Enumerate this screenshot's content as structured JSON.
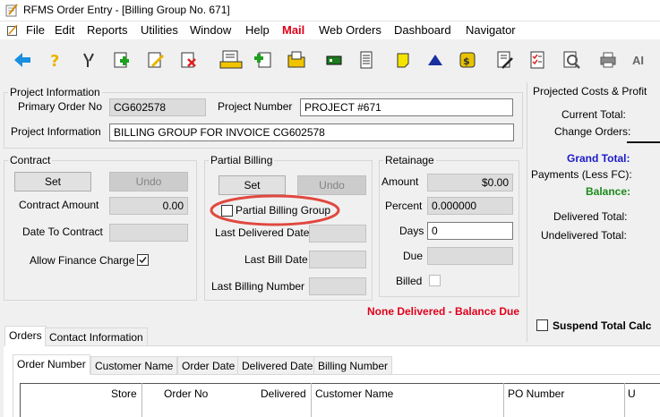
{
  "window": {
    "title": "RFMS Order Entry - [Billing Group No. 671]"
  },
  "menu": [
    "File",
    "Edit",
    "Reports",
    "Utilities",
    "Window",
    "Help",
    "Mail",
    "Web Orders",
    "Dashboard",
    "Navigator"
  ],
  "toolbar": {
    "icons": [
      "back-arrow-icon",
      "help-question-icon",
      "tools-icon",
      "add-order-icon",
      "edit-order-icon",
      "delete-order-icon",
      "printed-report-icon",
      "add-document-icon",
      "folder-icon",
      "green-card-icon",
      "document-icon",
      "sticky-note-icon",
      "triangle-icon",
      "calculator-icon",
      "signing-icon",
      "checklist-icon",
      "magnify-document-icon",
      "printer-icon",
      "ai-icon"
    ],
    "ai_label": "AI"
  },
  "project_info": {
    "legend": "Project Information",
    "primary_order_label": "Primary Order No",
    "primary_order_value": "CG602578",
    "project_number_label": "Project Number",
    "project_number_value": "PROJECT #671",
    "project_info_label": "Project Information",
    "project_info_value": "BILLING GROUP FOR INVOICE CG602578"
  },
  "contract": {
    "legend": "Contract",
    "set_label": "Set",
    "undo_label": "Undo",
    "amount_label": "Contract Amount",
    "amount_value": "0.00",
    "date_label": "Date To Contract",
    "date_value": "",
    "finance_label": "Allow Finance Charge",
    "finance_checked": true
  },
  "partial_billing": {
    "legend": "Partial Billing",
    "set_label": "Set",
    "undo_label": "Undo",
    "group_label": "Partial Billing Group",
    "last_delivered_label": "Last Delivered Date",
    "last_bill_label": "Last Bill Date",
    "last_billing_number_label": "Last Billing Number"
  },
  "retainage": {
    "legend": "Retainage",
    "amount_label": "Amount",
    "amount_value": "$0.00",
    "percent_label": "Percent",
    "percent_value": "0.000000",
    "days_label": "Days",
    "days_value": "0",
    "due_label": "Due",
    "due_value": "",
    "billed_label": "Billed"
  },
  "status_message": "None Delivered - Balance Due",
  "projected": {
    "title": "Projected Costs & Profit",
    "current_total": "Current Total:",
    "change_orders": "Change Orders:",
    "grand_total": "Grand Total:",
    "payments": "Payments (Less FC):",
    "balance": "Balance:",
    "delivered_total": "Delivered Total:",
    "undelivered_total": "Undelivered Total:",
    "suspend_label": "Suspend Total Calc"
  },
  "outer_tabs": [
    "Orders",
    "Contact Information"
  ],
  "inner_tabs": [
    "Order Number",
    "Customer Name",
    "Order Date",
    "Delivered Date",
    "Billing Number"
  ],
  "grid_headers": [
    "Store",
    "Order No",
    "Delivered",
    "Customer Name",
    "PO Number",
    "U"
  ],
  "colors": {
    "annotation": "#e0483f",
    "grand_total": "#1a1acc",
    "balance": "#1a8a1a",
    "status": "#e0001b"
  }
}
